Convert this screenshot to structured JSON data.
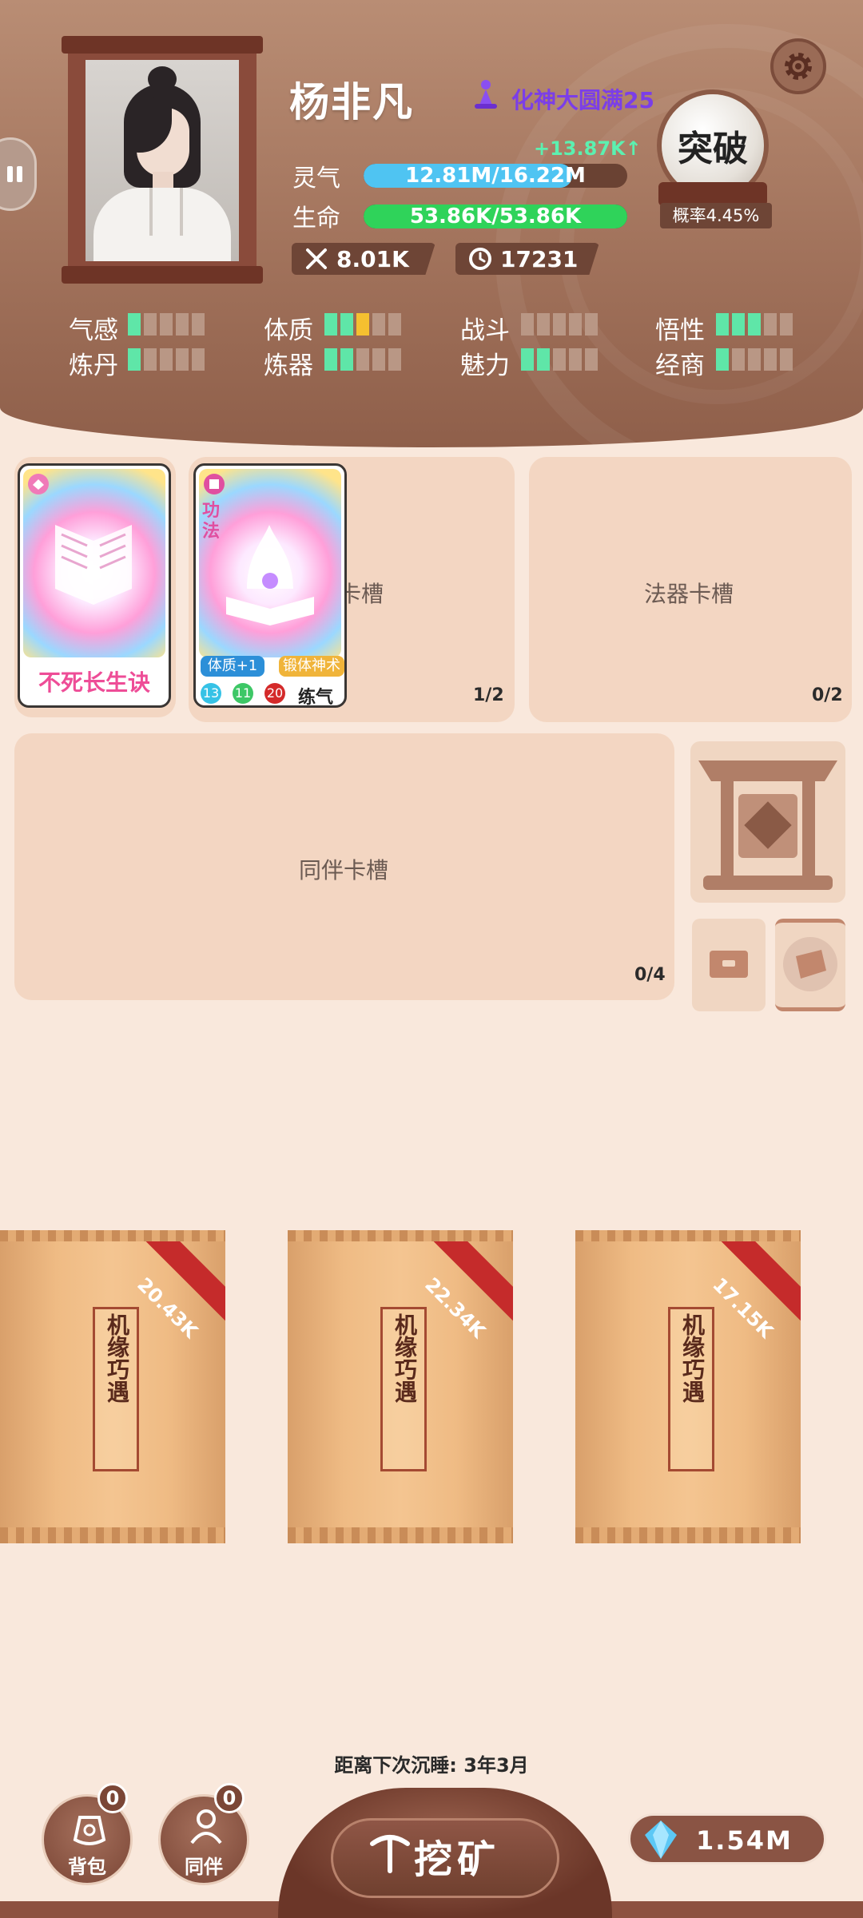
{
  "player": {
    "name": "杨非凡",
    "realm": "化神大圆满25",
    "spirit_gain": "+13.87K↑",
    "spirit_label": "灵气",
    "spirit_value": "12.81M/16.22M",
    "spirit_progress": 0.79,
    "life_label": "生命",
    "life_value": "53.86K/53.86K",
    "life_progress": 1.0,
    "attack": "8.01K",
    "lifespan": "17231",
    "breakthrough_label": "突破",
    "breakthrough_chance": "概率4.45%"
  },
  "attributes": [
    {
      "label": "气感",
      "level": 1,
      "gold": 0
    },
    {
      "label": "体质",
      "level": 3,
      "gold": 1
    },
    {
      "label": "战斗",
      "level": 0,
      "gold": 0
    },
    {
      "label": "悟性",
      "level": 3,
      "gold": 0
    },
    {
      "label": "炼丹",
      "level": 1,
      "gold": 0
    },
    {
      "label": "炼器",
      "level": 2,
      "gold": 0
    },
    {
      "label": "魅力",
      "level": 2,
      "gold": 0
    },
    {
      "label": "经商",
      "level": 1,
      "gold": 0
    }
  ],
  "slots": {
    "technique_label": "卡槽",
    "technique_count": "1/2",
    "artifact_label": "法器卡槽",
    "artifact_count": "0/2",
    "companion_label": "同伴卡槽",
    "companion_count": "0/4"
  },
  "cards": {
    "card1_name": "不死长生诀",
    "card2_type": "功法",
    "card2_tag1": "体质+1",
    "card2_tag2": "锻体神术",
    "card2_stat1": "13",
    "card2_stat2": "11",
    "card2_stat3": "20",
    "card2_realm": "练气"
  },
  "packs": [
    {
      "title": "机缘巧遇",
      "price": "20.43K"
    },
    {
      "title": "机缘巧遇",
      "price": "22.34K"
    },
    {
      "title": "机缘巧遇",
      "price": "17.15K"
    }
  ],
  "bottom": {
    "sleep_info": "距离下次沉睡: 3年3月",
    "bag_label": "背包",
    "bag_badge": "0",
    "companion_label": "同伴",
    "companion_badge": "0",
    "mine_label": "挖矿",
    "gems": "1.54M"
  },
  "colors": {
    "spirit_bar": "#4fc4f2",
    "life_bar": "#2fd35a",
    "pip_on": "#5fe6a8",
    "pip_gold": "#f5c030",
    "realm": "#7b3ee8",
    "ribbon": "#c52b2b"
  }
}
